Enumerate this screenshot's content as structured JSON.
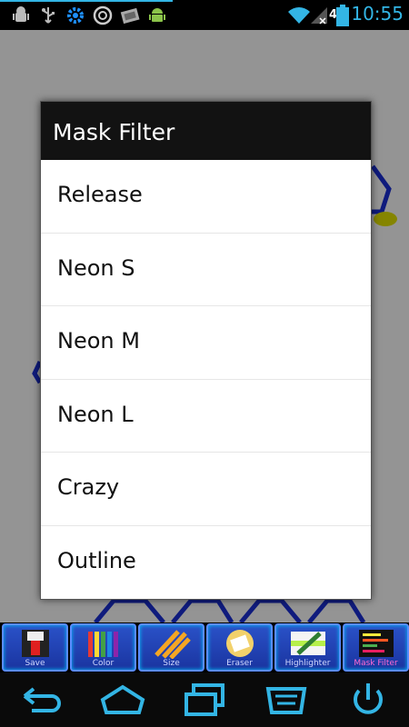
{
  "status_bar": {
    "battery_level": "42",
    "time": "10:55",
    "icons": [
      "android-debug-icon",
      "usb-icon",
      "settings-icon",
      "app-icon",
      "photo-icon",
      "android-icon",
      "wifi-icon",
      "no-signal-icon",
      "battery-icon"
    ],
    "time_color": "#33b5e5"
  },
  "dialog": {
    "title": "Mask Filter",
    "items": [
      {
        "label": "Release"
      },
      {
        "label": "Neon S"
      },
      {
        "label": "Neon M"
      },
      {
        "label": "Neon L"
      },
      {
        "label": "Crazy"
      },
      {
        "label": "Outline"
      }
    ]
  },
  "toolbar": {
    "items": [
      {
        "label": "Save",
        "icon": "save-icon"
      },
      {
        "label": "Color",
        "icon": "color-icon"
      },
      {
        "label": "Size",
        "icon": "size-icon"
      },
      {
        "label": "Eraser",
        "icon": "eraser-icon"
      },
      {
        "label": "Highlighter",
        "icon": "highlighter-icon"
      },
      {
        "label": "Mask Filter",
        "icon": "mask-filter-icon",
        "active": true
      }
    ]
  },
  "nav_bar": {
    "buttons": [
      "back-icon",
      "home-icon",
      "recent-apps-icon",
      "menu-icon",
      "power-icon"
    ]
  }
}
